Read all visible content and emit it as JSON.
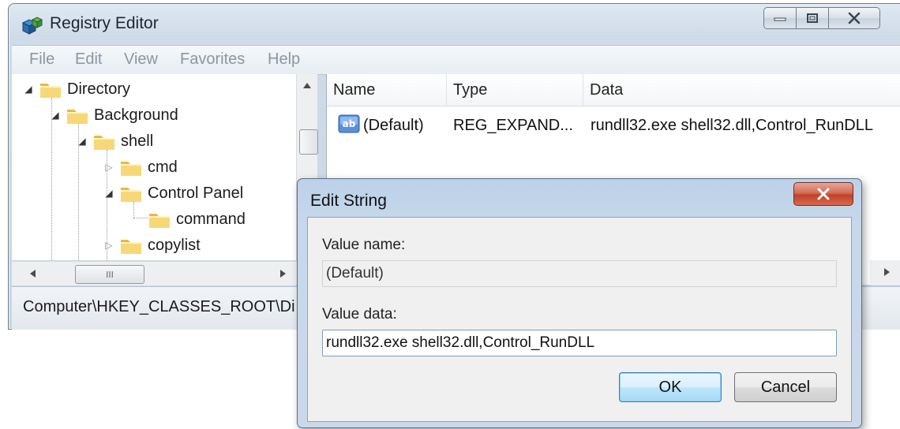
{
  "window": {
    "title": "Registry Editor",
    "icon": "registry-cubes-icon"
  },
  "menu": [
    "File",
    "Edit",
    "View",
    "Favorites",
    "Help"
  ],
  "tree": {
    "nodes": [
      {
        "label": "Directory",
        "level": 0,
        "state": "expanded"
      },
      {
        "label": "Background",
        "level": 1,
        "state": "expanded"
      },
      {
        "label": "shell",
        "level": 2,
        "state": "expanded"
      },
      {
        "label": "cmd",
        "level": 3,
        "state": "collapsed"
      },
      {
        "label": "Control Panel",
        "level": 3,
        "state": "expanded"
      },
      {
        "label": "command",
        "level": 4,
        "state": "leaf"
      },
      {
        "label": "copylist",
        "level": 3,
        "state": "collapsed"
      }
    ]
  },
  "list": {
    "columns": [
      "Name",
      "Type",
      "Data"
    ],
    "rows": [
      {
        "name": "(Default)",
        "type": "REG_EXPAND...",
        "data": "rundll32.exe shell32.dll,Control_RunDLL",
        "icon": "string-value-ab-icon"
      }
    ]
  },
  "status": {
    "path": "Computer\\HKEY_CLASSES_ROOT\\Di"
  },
  "dialog": {
    "title": "Edit String",
    "value_name_label": "Value name:",
    "value_name": "(Default)",
    "value_data_label": "Value data:",
    "value_data": "rundll32.exe shell32.dll,Control_RunDLL",
    "ok_label": "OK",
    "cancel_label": "Cancel"
  },
  "colors": {
    "folder": "#f2c94c",
    "accent": "#3c7fb1",
    "close_red": "#c1412a"
  }
}
